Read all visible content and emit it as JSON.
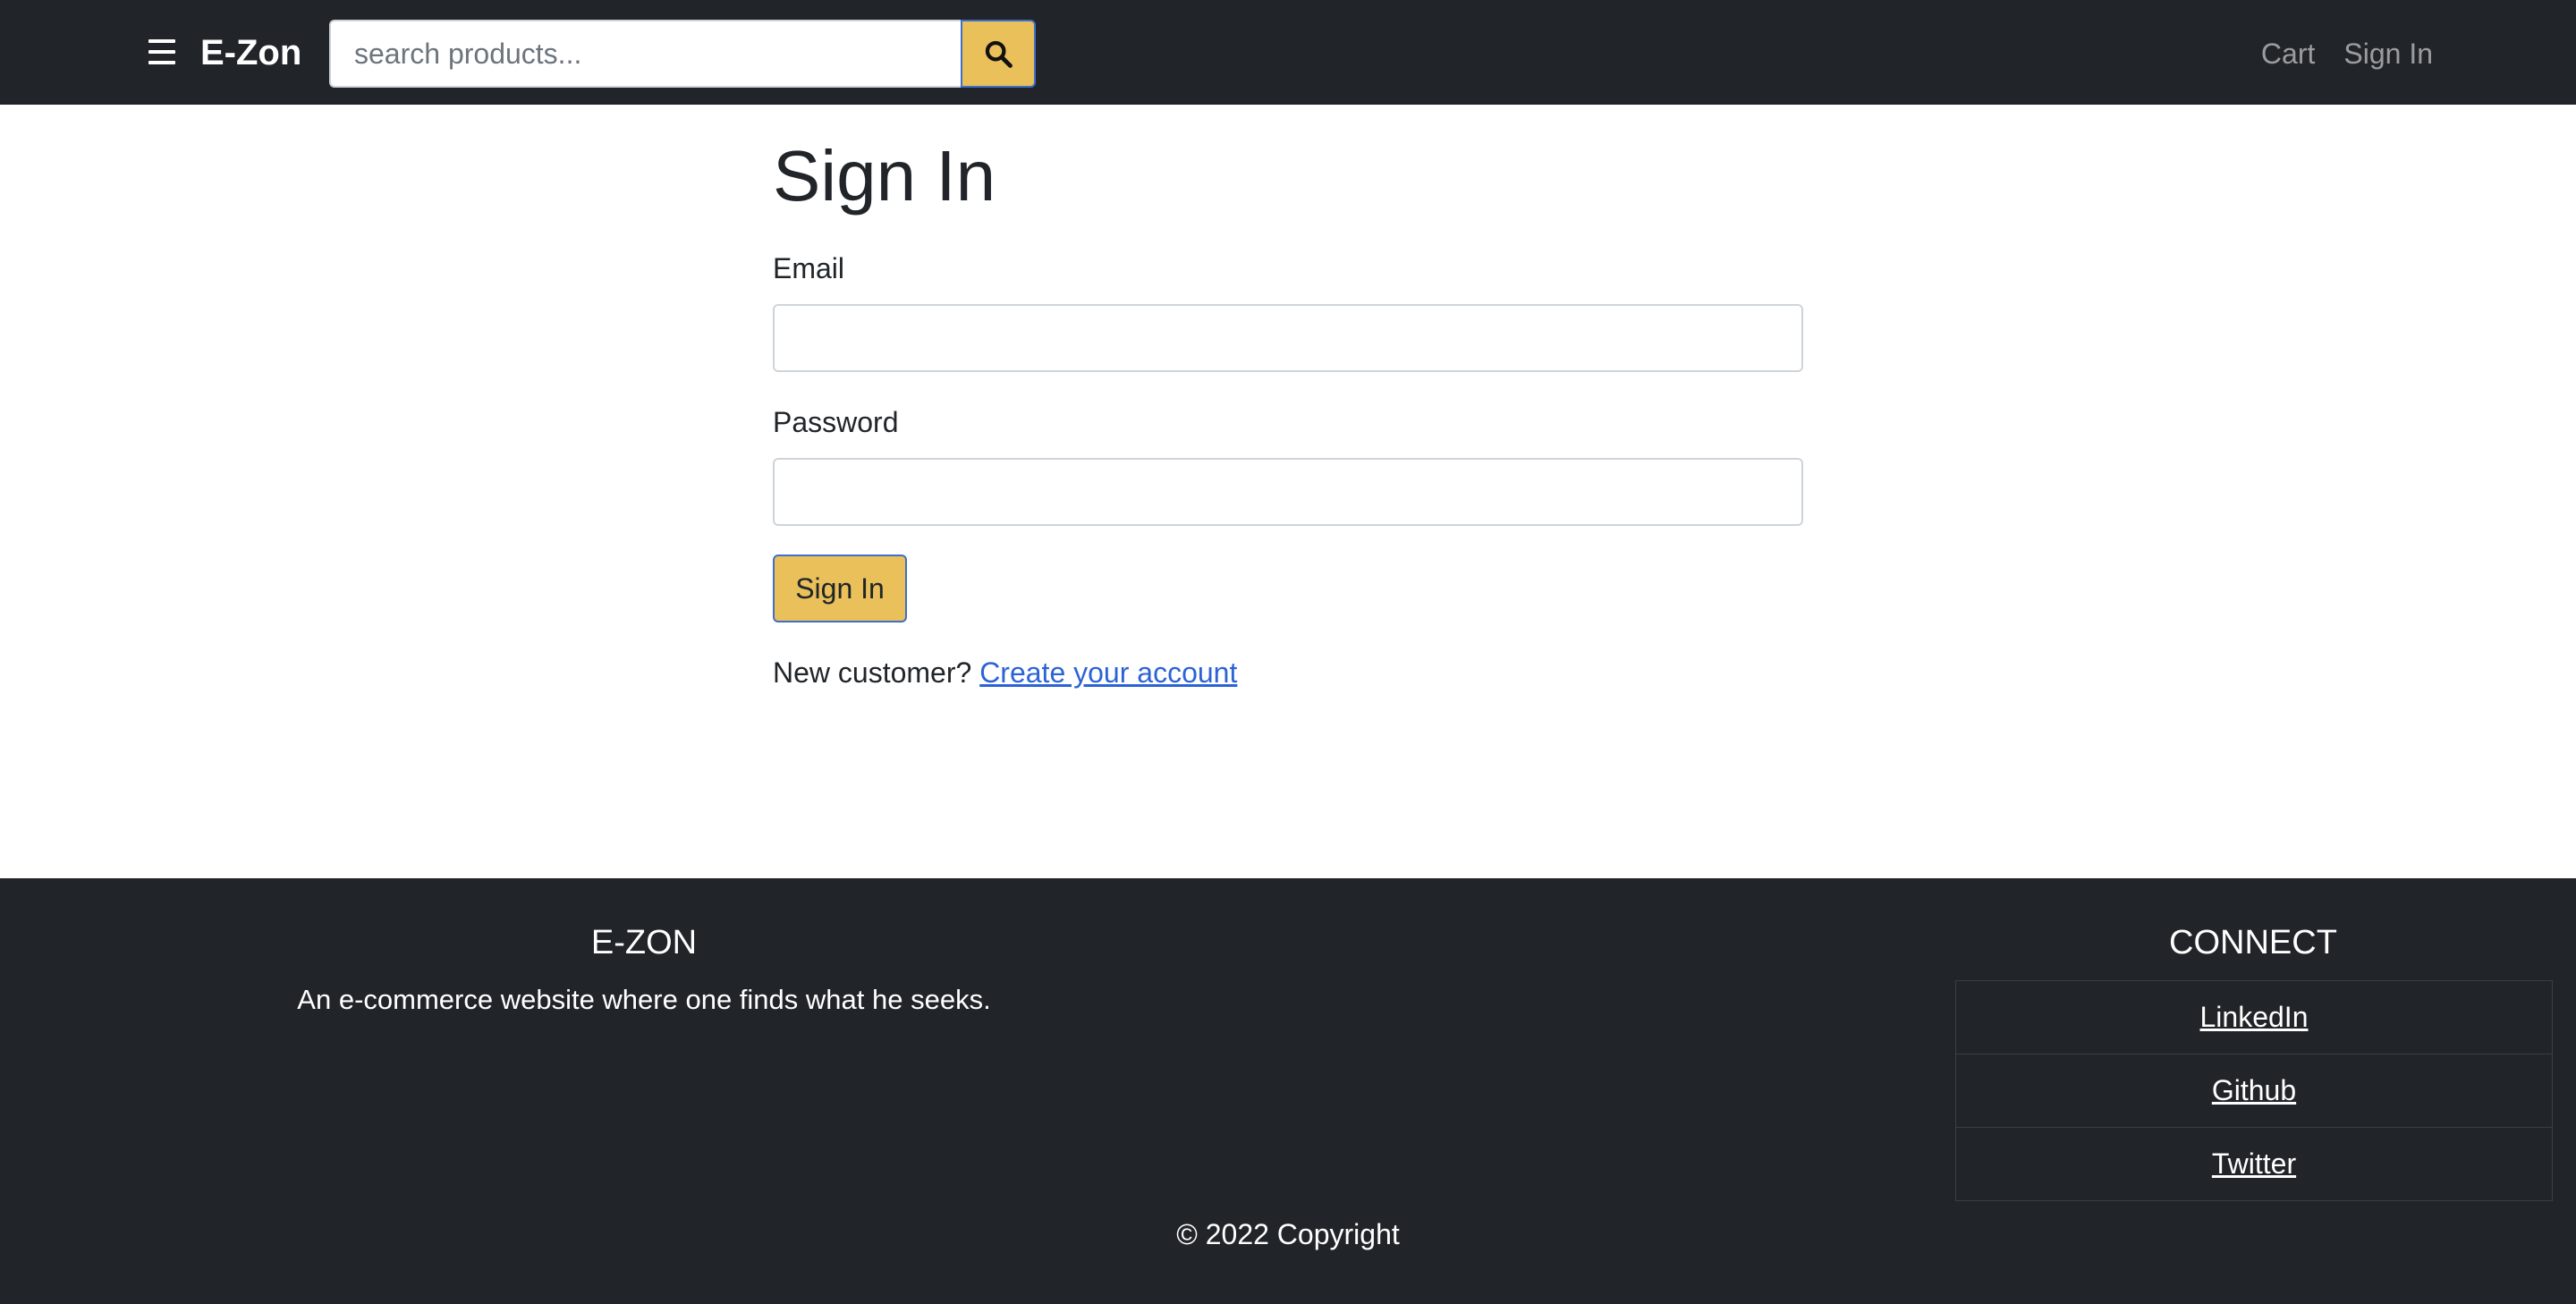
{
  "navbar": {
    "brand": "E-Zon",
    "menu_icon": "hamburger-menu-icon",
    "search": {
      "placeholder": "search products...",
      "value": "",
      "button_icon": "search-icon"
    },
    "links": {
      "cart": "Cart",
      "sign_in": "Sign In"
    }
  },
  "form": {
    "title": "Sign In",
    "email_label": "Email",
    "email_value": "",
    "password_label": "Password",
    "password_value": "",
    "submit_label": "Sign In",
    "new_customer_text": "New customer?",
    "create_account_link": "Create your account"
  },
  "footer": {
    "brand": "E-ZON",
    "description": "An e-commerce website where one finds what he seeks.",
    "connect_title": "CONNECT",
    "links": [
      "LinkedIn",
      "Github",
      "Twitter"
    ],
    "copyright": "© 2022 Copyright"
  },
  "colors": {
    "dark_bg": "#212529",
    "accent": "#e9c05a",
    "focus_border": "#3f6fc9",
    "link": "#2b63d6"
  }
}
